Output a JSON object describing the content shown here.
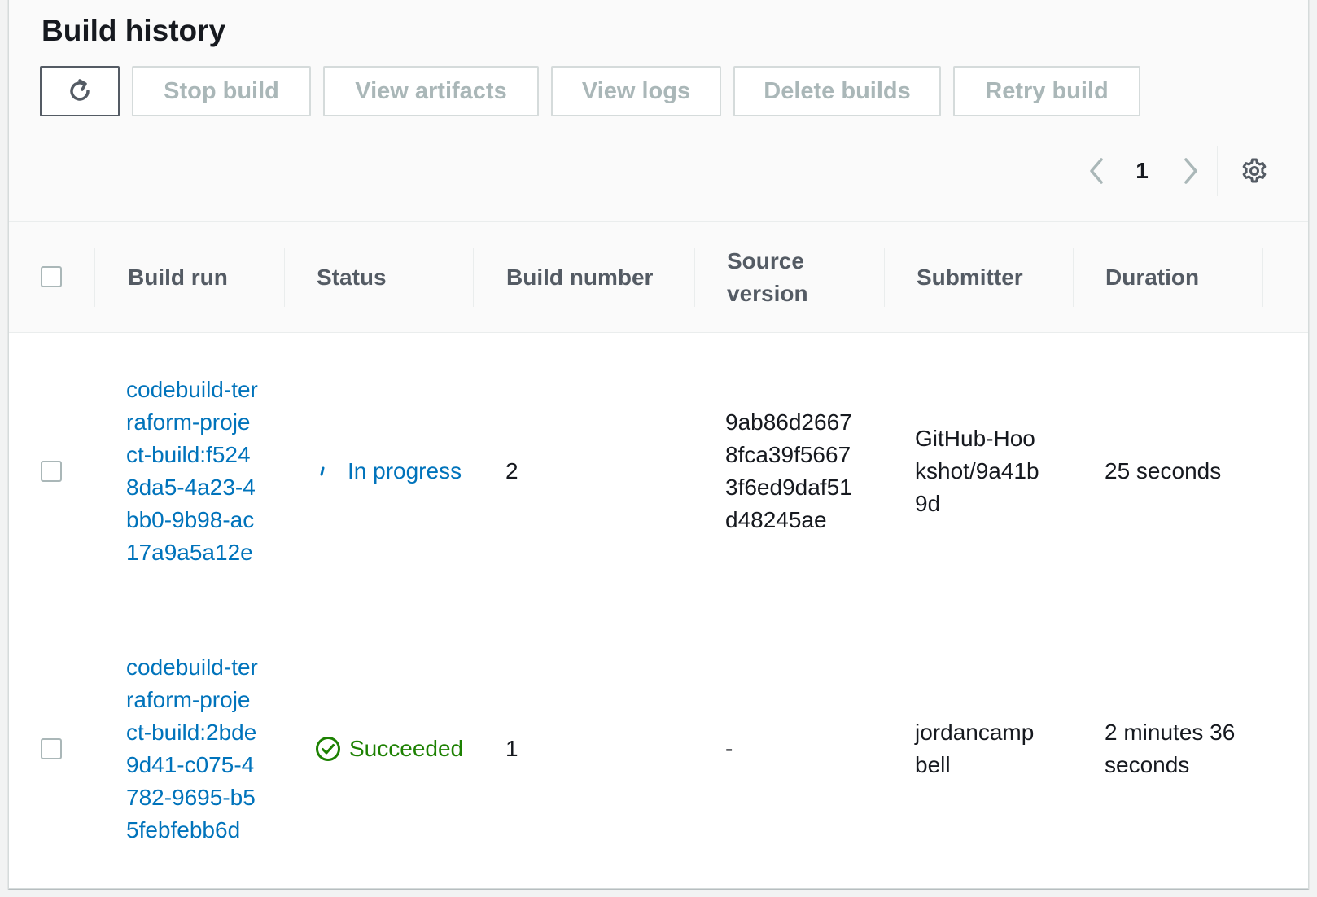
{
  "section": {
    "title": "Build history"
  },
  "toolbar": {
    "refresh_icon": "refresh-icon",
    "stop_build": "Stop build",
    "view_artifacts": "View artifacts",
    "view_logs": "View logs",
    "delete_builds": "Delete builds",
    "retry_build": "Retry build"
  },
  "pagination": {
    "current_page": "1",
    "prev_icon": "chevron-left-icon",
    "next_icon": "chevron-right-icon",
    "settings_icon": "gear-icon"
  },
  "table": {
    "columns": [
      "Build run",
      "Status",
      "Build number",
      "Source version",
      "Submitter",
      "Duration"
    ],
    "rows": [
      {
        "build_run": "codebuild-terraform-project-build:f5248da5-4a23-4bb0-9b98-ac17a9a5a12e",
        "status": "In progress",
        "status_icon": "spinner-icon",
        "build_number": "2",
        "source_version": "9ab86d26678fca39f56673f6ed9daf51d48245ae",
        "submitter": "GitHub-Hookshot/9a41b9d",
        "duration": "25 seconds"
      },
      {
        "build_run": "codebuild-terraform-project-build:2bde9d41-c075-4782-9695-b55febfebb6d",
        "status": "Succeeded",
        "status_icon": "check-circle-icon",
        "build_number": "1",
        "source_version": "-",
        "submitter": "jordancampbell",
        "duration": "2 minutes 36 seconds"
      }
    ]
  },
  "colors": {
    "link": "#0073bb",
    "success": "#1d8102",
    "disabled_text": "#aab7b8",
    "header_text": "#545b64"
  }
}
